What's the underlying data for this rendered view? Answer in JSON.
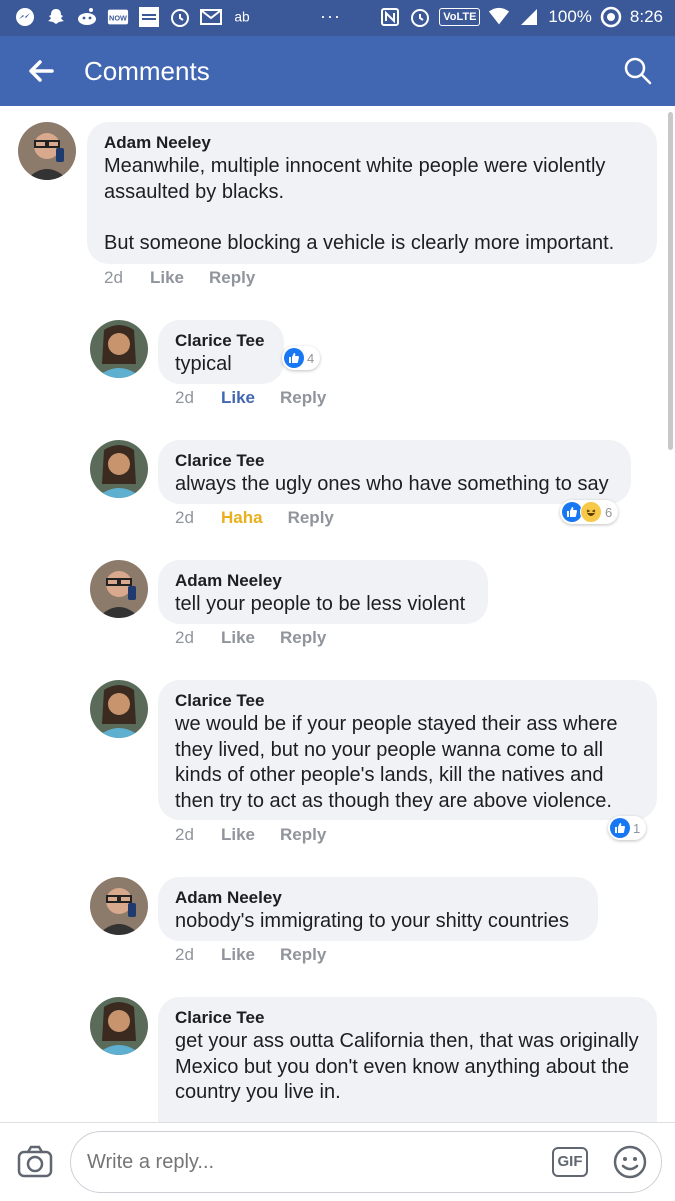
{
  "status_bar": {
    "volte": "VoLTE",
    "battery": "100%",
    "time": "8:26"
  },
  "header": {
    "title": "Comments"
  },
  "comments": [
    {
      "author": "Adam Neeley",
      "text": "Meanwhile, multiple innocent white people were violently assaulted by blacks.\n\nBut someone blocking a vehicle is clearly more important.",
      "time": "2d",
      "like": "Like",
      "reply": "Reply"
    },
    {
      "author": "Clarice Tee",
      "text": "typical",
      "time": "2d",
      "like": "Like",
      "reply": "Reply",
      "reaction_count": "4"
    },
    {
      "author": "Clarice Tee",
      "text": "always the ugly ones who have something to say",
      "time": "2d",
      "like": "Haha",
      "reply": "Reply",
      "reaction_count": "6"
    },
    {
      "author": "Adam Neeley",
      "text": "tell your people to be less violent",
      "time": "2d",
      "like": "Like",
      "reply": "Reply"
    },
    {
      "author": "Clarice Tee",
      "text": "we would be if your people stayed their ass where they lived, but no your people wanna come to all kinds of other people's lands, kill the natives and then try to act as though they are above violence.",
      "time": "2d",
      "like": "Like",
      "reply": "Reply",
      "reaction_count": "1"
    },
    {
      "author": "Adam Neeley",
      "text": "nobody's immigrating to your shitty countries",
      "time": "2d",
      "like": "Like",
      "reply": "Reply"
    },
    {
      "author": "Clarice Tee",
      "text": "get your ass outta California then, that was originally Mexico but you don't even know anything about the country you live in."
    }
  ],
  "composer": {
    "placeholder": "Write a reply...",
    "gif_label": "GIF"
  },
  "colors": {
    "facebook_blue": "#4267b2",
    "status_blue": "#3b5998",
    "bubble": "#f0f2f5",
    "haha": "#e9b01c"
  },
  "icons": [
    "back-arrow-icon",
    "search-icon",
    "camera-icon",
    "gif-icon",
    "emoji-icon",
    "like-reaction-icon",
    "haha-reaction-icon"
  ]
}
